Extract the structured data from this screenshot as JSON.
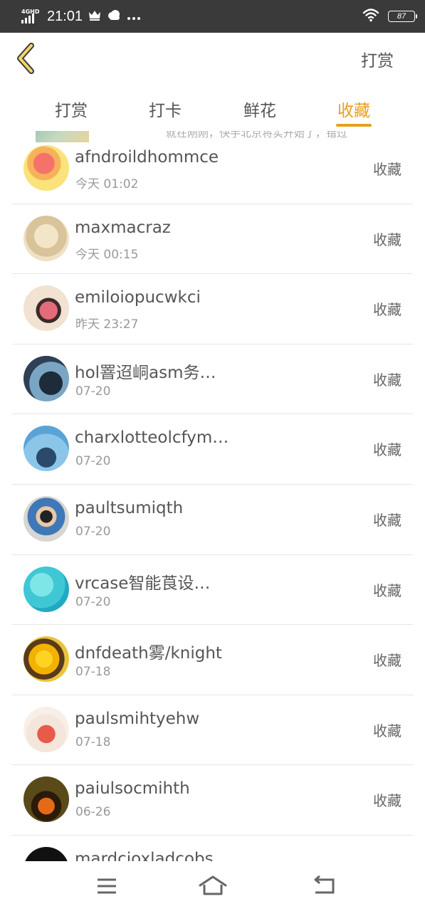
{
  "status_bar": {
    "network_label": "4GHD",
    "time": "21:01",
    "battery": "87",
    "icons": [
      "crown-icon",
      "weather-icon",
      "more-icon",
      "wifi-icon",
      "battery-icon"
    ]
  },
  "header": {
    "back_icon": "chevron-left-icon",
    "action_label": "打赏"
  },
  "tabs": [
    {
      "label": "打赏",
      "active": false
    },
    {
      "label": "打卡",
      "active": false
    },
    {
      "label": "鲜花",
      "active": false
    },
    {
      "label": "收藏",
      "active": true
    }
  ],
  "peek": {
    "text": "就在刚刚，快手北京将实开始了，错过"
  },
  "list": [
    {
      "name": "afndroildhommce",
      "date": "今天 01:02",
      "action": "收藏"
    },
    {
      "name": "maxmacraz",
      "date": "今天 00:15",
      "action": "收藏"
    },
    {
      "name": "emiloiopucwkci",
      "date": "昨天 23:27",
      "action": "收藏"
    },
    {
      "name": "hol罯迢峒asm务…",
      "date": "07-20",
      "action": "收藏"
    },
    {
      "name": "charxlotteolcfym…",
      "date": "07-20",
      "action": "收藏"
    },
    {
      "name": "paultsumiqth",
      "date": "07-20",
      "action": "收藏"
    },
    {
      "name": "vrcase智能莨设…",
      "date": "07-20",
      "action": "收藏"
    },
    {
      "name": "dnfdeath雾/knight",
      "date": "07-18",
      "action": "收藏"
    },
    {
      "name": "paulsmihtyehw",
      "date": "07-18",
      "action": "收藏"
    },
    {
      "name": "paiulsocmihth",
      "date": "06-26",
      "action": "收藏"
    },
    {
      "name": "mardcioxladcobs",
      "date": "",
      "action": ""
    }
  ],
  "bottom_nav": {
    "icons": [
      "menu-icon",
      "home-icon",
      "back-icon"
    ]
  },
  "colors": {
    "accent": "#e89f1c",
    "status_bar_bg": "#3a3a3a",
    "divider": "#e6e6e6"
  }
}
